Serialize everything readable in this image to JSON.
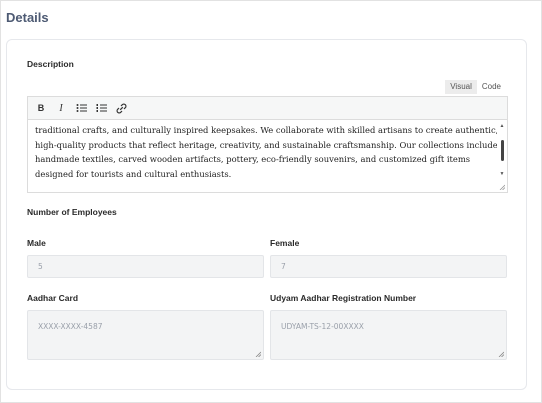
{
  "section": {
    "title": "Details"
  },
  "description": {
    "label": "Description",
    "tabs": [
      {
        "label": "Visual"
      },
      {
        "label": "Code"
      }
    ],
    "toolbar": {
      "bold": "B",
      "italic": "I"
    },
    "lines": [
      "traditional crafts, and culturally inspired keepsakes. We collaborate with skilled artisans to create authentic,",
      "high-quality products that reflect heritage, creativity, and sustainable craftsmanship. Our collections include",
      "handmade textiles, carved wooden artifacts, pottery, eco-friendly souvenirs, and customized gift items",
      "designed for tourists and cultural enthusiasts."
    ]
  },
  "employees": {
    "heading": "Number of Employees",
    "male_label": "Male",
    "male_value": "5",
    "female_label": "Female",
    "female_value": "7"
  },
  "aadhar": {
    "label": "Aadhar Card",
    "placeholder": "XXXX-XXXX-4587"
  },
  "udyam": {
    "label": "Udyam Aadhar Registration Number",
    "placeholder": "UDYAM-TS-12-00XXXX"
  }
}
